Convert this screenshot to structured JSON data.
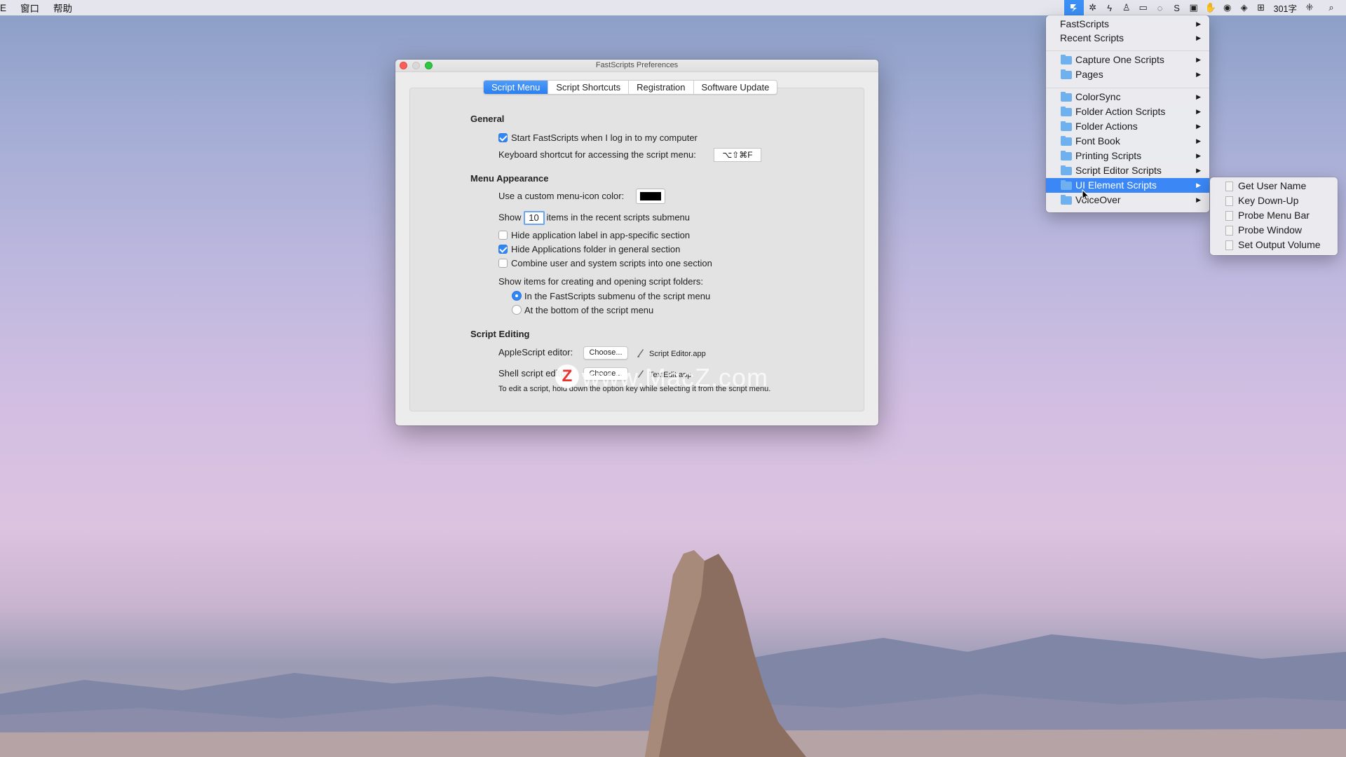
{
  "menubar": {
    "left_items": [
      "E",
      "窗口",
      "帮助"
    ],
    "right_text": "301字",
    "icons": [
      "fastscripts-icon",
      "sparkle-icon",
      "bolt-icon",
      "person-icon",
      "camera-icon",
      "chat-icon",
      "s-icon",
      "screen-icon",
      "hand-icon",
      "record-icon",
      "shield-icon",
      "grid-icon",
      "dots-icon",
      "search-icon"
    ]
  },
  "window": {
    "title": "FastScripts Preferences",
    "tabs": [
      "Script Menu",
      "Script Shortcuts",
      "Registration",
      "Software Update"
    ],
    "general": {
      "heading": "General",
      "start_login": "Start FastScripts when I log in to my computer",
      "shortcut_label": "Keyboard shortcut for accessing the script menu:",
      "shortcut_value": "⌥⇧⌘F"
    },
    "appearance": {
      "heading": "Menu Appearance",
      "custom_color": "Use a custom menu-icon color:",
      "show_prefix": "Show",
      "show_value": "10",
      "show_suffix": "items in the recent scripts submenu",
      "hide_app_label": "Hide application label in app-specific section",
      "hide_apps_folder": "Hide Applications folder in general section",
      "combine": "Combine user and system scripts into one section",
      "folders_label": "Show items for creating and opening script folders:",
      "radio_1": "In the FastScripts submenu of the script menu",
      "radio_2": "At the bottom of the script menu"
    },
    "editing": {
      "heading": "Script Editing",
      "applescript_label": "AppleScript editor:",
      "choose": "Choose...",
      "applescript_app": "Script Editor.app",
      "shell_label": "Shell script editor:",
      "shell_app": "TextEdit.app",
      "note": "To edit a script, hold down the option key while selecting it from the script menu."
    }
  },
  "menu": {
    "top_items": [
      "FastScripts",
      "Recent Scripts"
    ],
    "group1": [
      "Capture One Scripts",
      "Pages"
    ],
    "group2": [
      "ColorSync",
      "Folder Action Scripts",
      "Folder Actions",
      "Font Book",
      "Printing Scripts",
      "Script Editor Scripts",
      "UI Element Scripts",
      "VoiceOver"
    ],
    "highlighted": "UI Element Scripts"
  },
  "submenu": {
    "items": [
      "Get User Name",
      "Key Down-Up",
      "Probe Menu Bar",
      "Probe Window",
      "Set Output Volume"
    ]
  },
  "watermark": {
    "logo": "Z",
    "text": "www.MacZ.com"
  },
  "colors": {
    "accent": "#3a87f5",
    "folder": "#6fb1ef"
  }
}
